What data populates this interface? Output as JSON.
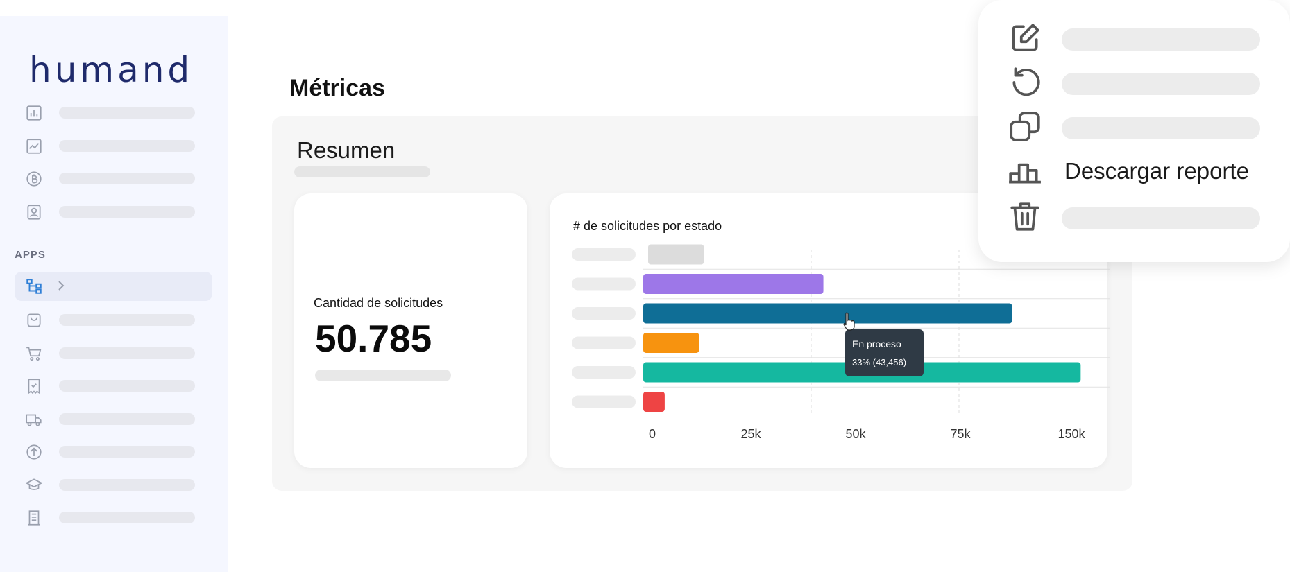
{
  "brand": {
    "logo_text": "humand",
    "logo_color": "#1f2a6b"
  },
  "sidebar": {
    "apps_label": "APPS",
    "top_items": [
      {
        "icon": "bar-chart-icon"
      },
      {
        "icon": "line-chart-icon"
      },
      {
        "icon": "bitcoin-coin-icon"
      },
      {
        "icon": "user-card-icon"
      }
    ],
    "active_item": {
      "icon": "org-chart-icon"
    },
    "app_items": [
      {
        "icon": "shopping-bag-icon"
      },
      {
        "icon": "shopping-cart-icon"
      },
      {
        "icon": "checklist-receipt-icon"
      },
      {
        "icon": "delivery-truck-icon"
      },
      {
        "icon": "upload-circle-icon"
      },
      {
        "icon": "graduation-cap-icon"
      },
      {
        "icon": "building-icon"
      }
    ]
  },
  "main": {
    "title": "Métricas",
    "summary_title": "Resumen",
    "count_card": {
      "label": "Cantidad de solicitudes",
      "value": "50.785"
    },
    "chart_card": {
      "title": "# de solicitudes por estado"
    },
    "tooltip": {
      "label": "En proceso",
      "value": "33% (43,456)"
    }
  },
  "context_menu": {
    "items": [
      {
        "icon": "edit-icon"
      },
      {
        "icon": "refresh-icon"
      },
      {
        "icon": "duplicate-icon"
      },
      {
        "icon": "podium-icon",
        "label": "Descargar reporte"
      },
      {
        "icon": "trash-icon"
      }
    ]
  },
  "chart_data": {
    "type": "bar",
    "orientation": "horizontal",
    "title": "# de solicitudes por estado",
    "xticks": [
      "0",
      "25k",
      "50k",
      "75k",
      "150k"
    ],
    "xtick_values": [
      0,
      25000,
      50000,
      75000,
      100000
    ],
    "series": [
      {
        "values": [
          13000,
          42000,
          86000,
          13000,
          102000,
          5000
        ],
        "colors": [
          "#dcdcdc",
          "#9d77e8",
          "#0f6e96",
          "#f7930f",
          "#15b8a0",
          "#ee4444"
        ]
      }
    ],
    "highlighted_index": 2,
    "grid": true
  }
}
